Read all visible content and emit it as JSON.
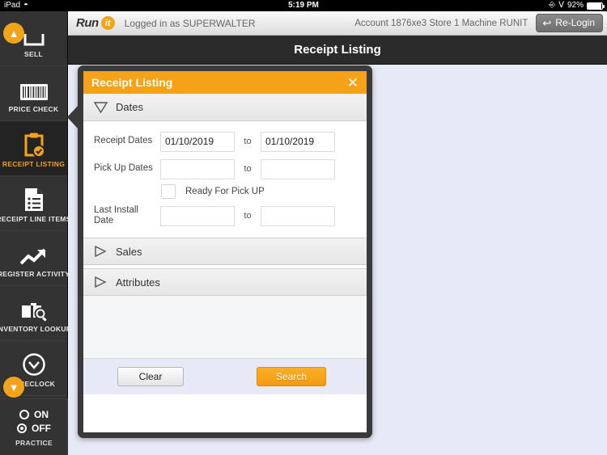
{
  "status_bar": {
    "device": "iPad",
    "wifi_icon": "wifi-icon",
    "time": "5:19 PM",
    "lock_rotation_icon": "rotation-lock-icon",
    "bluetooth_icon": "bluetooth-icon",
    "battery_percent": "92%"
  },
  "app_bar": {
    "logo_run": "Run",
    "logo_it": "it",
    "login_text": "Logged in as SUPERWALTER",
    "account_text": "Account 1876xe3 Store 1 Machine RUNIT",
    "relogin_label": "Re-Login"
  },
  "page": {
    "title": "Receipt Listing"
  },
  "sidebar": {
    "items": [
      {
        "label": "SELL",
        "icon": "sell-icon",
        "active": false
      },
      {
        "label": "PRICE CHECK",
        "icon": "barcode-icon",
        "active": false
      },
      {
        "label": "RECEIPT LISTING",
        "icon": "clipboard-check-icon",
        "active": true
      },
      {
        "label": "RECEIPT LINE ITEMS",
        "icon": "document-list-icon",
        "active": false
      },
      {
        "label": "REGISTER ACTIVITY",
        "icon": "trending-up-icon",
        "active": false
      },
      {
        "label": "INVENTORY LOOKUP",
        "icon": "box-search-icon",
        "active": false
      },
      {
        "label": "TIMECLOCK",
        "icon": "clock-icon",
        "active": false
      },
      {
        "label": "",
        "icon": "tent-icon",
        "active": false
      }
    ],
    "scroll_up_badge": "▲",
    "scroll_down_badge": "▼",
    "practice": {
      "on_label": "ON",
      "off_label": "OFF",
      "title": "PRACTICE",
      "selected": "OFF"
    }
  },
  "modal": {
    "title": "Receipt Listing",
    "close_label": "✕",
    "accent_color": "#f5a218",
    "sections": [
      {
        "label": "Dates",
        "expanded": true
      },
      {
        "label": "Sales",
        "expanded": false
      },
      {
        "label": "Attributes",
        "expanded": false
      }
    ],
    "fields": {
      "receipt_dates": {
        "label": "Receipt Dates",
        "from_value": "01/10/2019",
        "to_word": "to",
        "to_value": "01/10/2019"
      },
      "pick_up_dates": {
        "label": "Pick Up Dates",
        "from_value": "",
        "to_word": "to",
        "to_value": ""
      },
      "ready_for_pickup": {
        "label": "Ready For Pick UP",
        "checked": false
      },
      "last_install_date": {
        "label": "Last Install Date",
        "from_value": "",
        "to_word": "to",
        "to_value": ""
      }
    },
    "footer": {
      "clear_label": "Clear",
      "search_label": "Search"
    }
  }
}
